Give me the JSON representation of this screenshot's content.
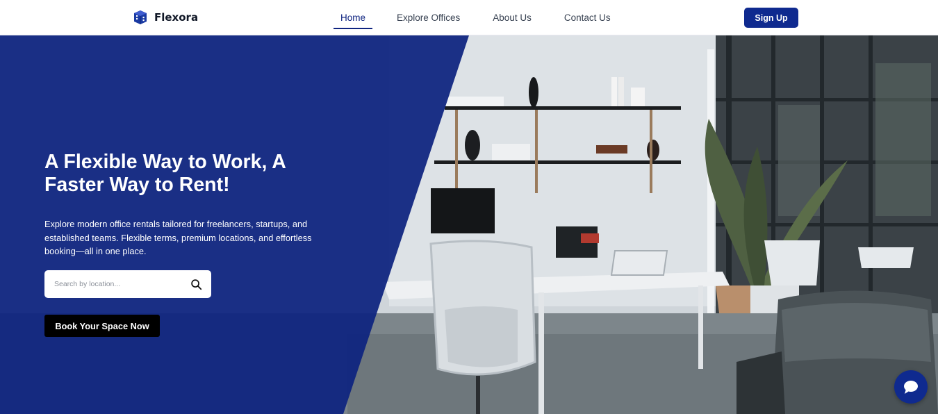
{
  "brand": {
    "name": "Flexora",
    "color": "#0f2a8f"
  },
  "nav": {
    "items": [
      {
        "label": "Home",
        "active": true
      },
      {
        "label": "Explore Offices",
        "active": false
      },
      {
        "label": "About Us",
        "active": false
      },
      {
        "label": "Contact Us",
        "active": false
      }
    ],
    "signup_label": "Sign Up"
  },
  "hero": {
    "title": "A Flexible Way to Work, A Faster Way to Rent!",
    "description": "Explore modern office rentals tailored for freelancers, startups, and established teams. Flexible terms, premium locations, and effortless booking—all in one place.",
    "search": {
      "placeholder": "Search by location...",
      "value": "",
      "icon": "search-icon"
    },
    "cta_label": "Book Your Space Now",
    "panel_color": "#0f2480"
  },
  "chat": {
    "icon": "chat-bubble-icon"
  }
}
